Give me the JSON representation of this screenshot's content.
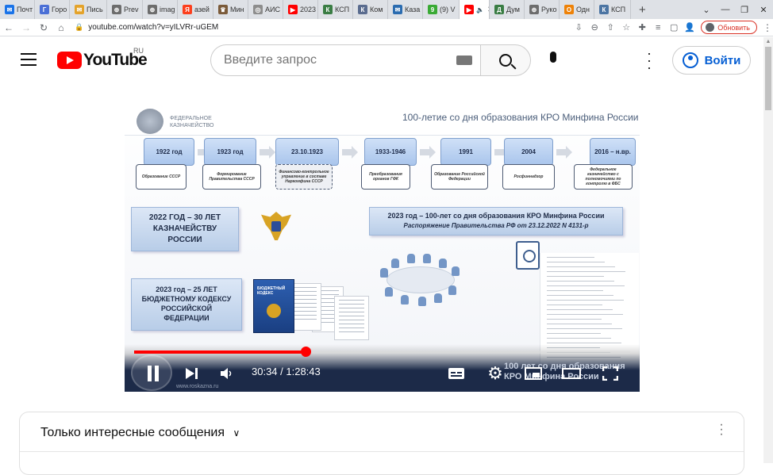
{
  "browser": {
    "tabs": [
      {
        "label": "Почт",
        "color": "#1a73e8",
        "glyph": "✉"
      },
      {
        "label": "Горо",
        "color": "#4a6fd6",
        "glyph": "Г"
      },
      {
        "label": "Пись",
        "color": "#e4a32b",
        "glyph": "✉"
      },
      {
        "label": "Prev",
        "color": "#6d6d6d",
        "glyph": "⊕"
      },
      {
        "label": "imag",
        "color": "#6d6d6d",
        "glyph": "⊕"
      },
      {
        "label": "азей",
        "color": "#fc3f1d",
        "glyph": "Я"
      },
      {
        "label": "Мин",
        "color": "#7b5b3a",
        "glyph": "♛"
      },
      {
        "label": "АИС",
        "color": "#8d8d8d",
        "glyph": "◎"
      },
      {
        "label": "2023",
        "color": "#ff0000",
        "glyph": "▶"
      },
      {
        "label": "КСП",
        "color": "#3a7d44",
        "glyph": "К"
      },
      {
        "label": "Ком",
        "color": "#5a6c8f",
        "glyph": "К"
      },
      {
        "label": "Каза",
        "color": "#2b6cb0",
        "glyph": "✉"
      },
      {
        "label": "(9) V",
        "color": "#3aaa35",
        "glyph": "9"
      },
      {
        "label": "",
        "color": "#ff0000",
        "glyph": "▶",
        "active": true,
        "audio_icon": "speaker-icon",
        "audio": "🔈"
      },
      {
        "label": "Дум",
        "color": "#3a7d44",
        "glyph": "Д"
      },
      {
        "label": "Руко",
        "color": "#6d6d6d",
        "glyph": "⊕"
      },
      {
        "label": "Одн",
        "color": "#ee8208",
        "glyph": "О"
      },
      {
        "label": "КСП",
        "color": "#4c75a3",
        "glyph": "К"
      }
    ],
    "new_tab": "+",
    "window_controls": [
      "⌄",
      "—",
      "❐",
      "✕"
    ],
    "url": "youtube.com/watch?v=yILVRr-uGEM",
    "update_label": "Обновить",
    "nav": {
      "back": "←",
      "forward": "→",
      "reload": "↻",
      "home": "⌂"
    },
    "addr_icons": [
      "⇩",
      "⊖",
      "⇧",
      "☆",
      "✚",
      "≡",
      "▢",
      "👤"
    ]
  },
  "youtube": {
    "logo_text": "YouTube",
    "region": "RU",
    "search_placeholder": "Введите запрос",
    "signin_label": "Войти"
  },
  "video": {
    "progress_fraction": 0.346,
    "time_current": "30:34",
    "time_total": "1:28:43",
    "time_label": "30:34 / 1:28:43",
    "controls": [
      "pause-icon",
      "next-icon",
      "volume-icon",
      "subtitles-icon",
      "settings-icon",
      "miniplayer-icon",
      "theater-icon",
      "fullscreen-icon"
    ],
    "overlay_text": [
      "100 лет со дня образования",
      "КРО Минфина России"
    ],
    "watermark": "www.roskazna.ru",
    "slide": {
      "org": "ФЕДЕРАЛЬНОЕ КАЗНАЧЕЙСТВО",
      "title": "100-летие со дня образования КРО Минфина России",
      "timeline": [
        {
          "year": "1922 год",
          "text": "Образование СССР"
        },
        {
          "year": "1923 год",
          "text": "Формирование Правительства СССР"
        },
        {
          "year": "23.10.1923",
          "text": "Финансово-контрольное управление в составе Наркомфина СССР"
        },
        {
          "year": "1933-1946",
          "text": "Преобразования органов ГФК"
        },
        {
          "year": "1991",
          "text": "Образование Российской Федерации"
        },
        {
          "year": "2004",
          "text": "Росфиннадзор"
        },
        {
          "year": "2016 – н.вр.",
          "text": "Федеральное казначейство с полномочиями по контролю в ФБС"
        }
      ],
      "box_treasury": [
        "2022 ГОД – 30 ЛЕТ",
        "КАЗНАЧЕЙСТВУ",
        "РОССИИ"
      ],
      "box_code": [
        "2023 год – 25 ЛЕТ",
        "БЮДЖЕТНОМУ КОДЕКСУ",
        "РОССИЙСКОЙ",
        "ФЕДЕРАЦИИ"
      ],
      "box_kro_title": "2023 год – 100-лет со дня образования КРО Минфина России",
      "box_kro_sub": "Распоряжение Правительства РФ от 23.12.2022 N 4131-р",
      "book_title": "БЮДЖЕТНЫЙ КОДЕКС"
    }
  },
  "comments": {
    "filter_label": "Только интересные сообщения",
    "chevron": "∨",
    "menu": "⋮"
  }
}
